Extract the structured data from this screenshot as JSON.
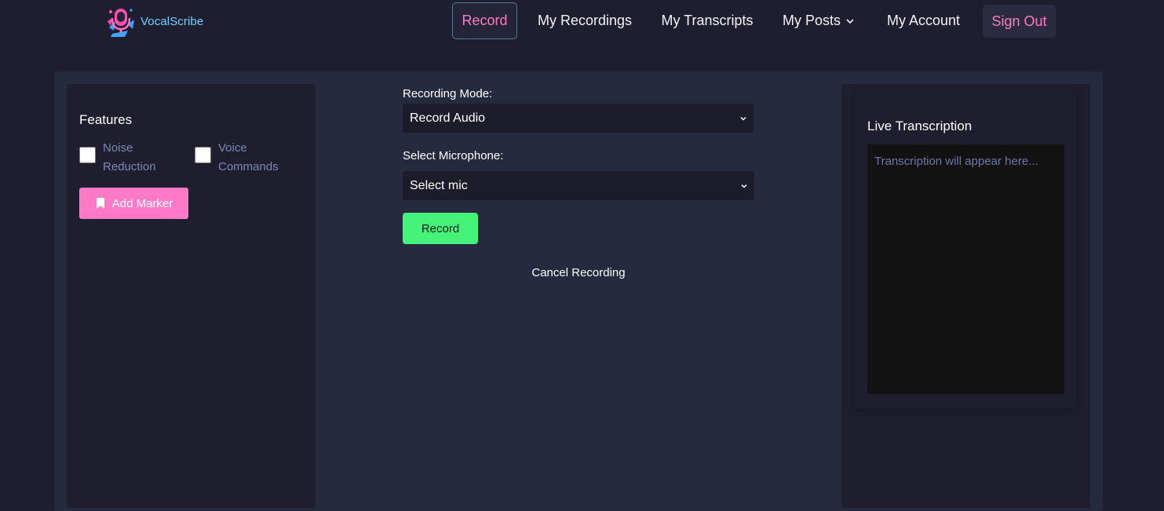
{
  "brand": {
    "name": "VocalScribe",
    "logo_icon": "microphone-logo-icon"
  },
  "nav": {
    "record": "Record",
    "my_recordings": "My Recordings",
    "my_transcripts": "My Transcripts",
    "my_posts": "My Posts",
    "my_account": "My Account",
    "sign_out": "Sign Out"
  },
  "features": {
    "title": "Features",
    "noise_reduction": {
      "label": "Noise Reduction",
      "checked": false
    },
    "voice_commands": {
      "label": "Voice Commands",
      "checked": false
    },
    "add_marker": "Add Marker"
  },
  "recorder": {
    "mode_label": "Recording Mode:",
    "mode_value": "Record Audio",
    "mic_label": "Select Microphone:",
    "mic_value": "Select mic",
    "record_button": "Record",
    "cancel": "Cancel Recording"
  },
  "live": {
    "title": "Live Transcription",
    "placeholder": "Transcription will appear here..."
  },
  "colors": {
    "background": "#1f1e30",
    "accent_pink": "#ff7ac6",
    "record_green": "#45f27a",
    "brand_cyan": "#6fd3ff"
  }
}
